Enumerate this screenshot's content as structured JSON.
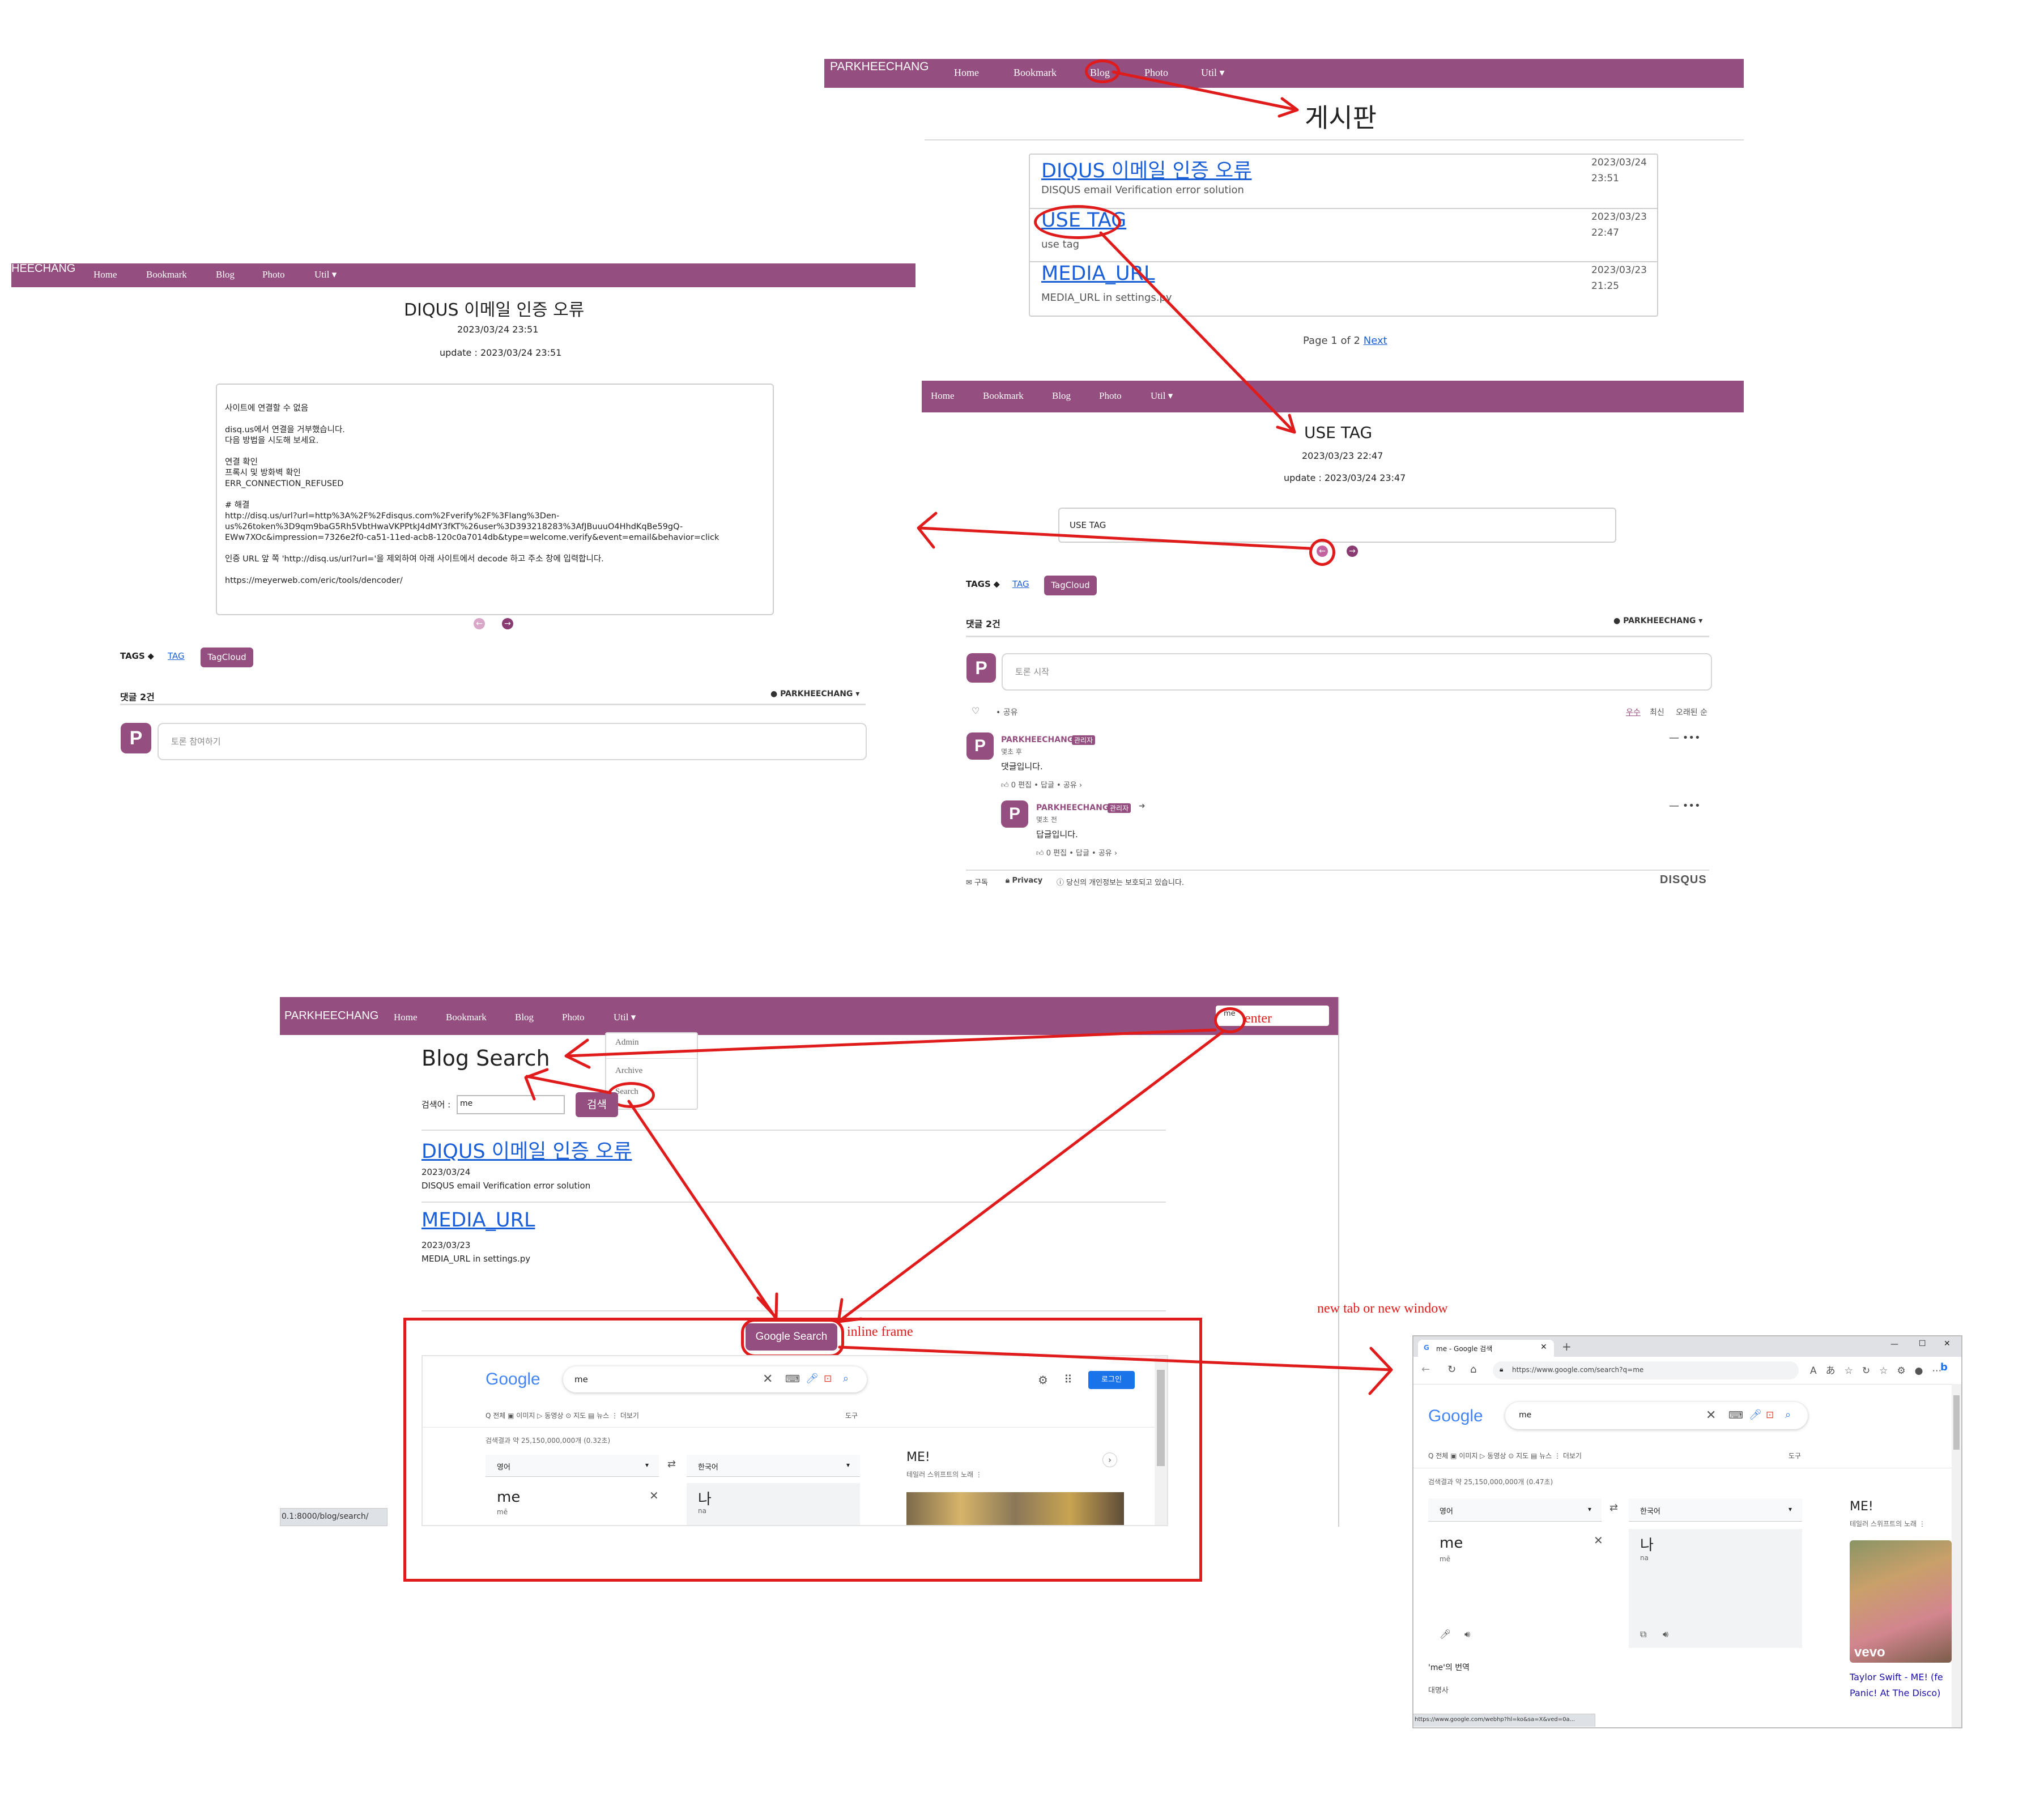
{
  "nav": {
    "brand": "PARKHEECHANG",
    "brand_cut": "HEECHANG",
    "home": "Home",
    "bookmark": "Bookmark",
    "blog": "Blog",
    "photo": "Photo",
    "util": "Util ▾"
  },
  "board": {
    "heading": "게시판",
    "posts": [
      {
        "title": "DIQUS 이메일 인증 오류",
        "summary": "DISQUS email Verification error solution",
        "date": "2023/03/24",
        "time": "23:51"
      },
      {
        "title": "USE TAG",
        "summary": "use tag",
        "date": "2023/03/23",
        "time": "22:47"
      },
      {
        "title": "MEDIA_URL",
        "summary": "MEDIA_URL in settings.py",
        "date": "2023/03/23",
        "time": "21:25"
      }
    ],
    "pagination_prefix": "Page 1 of 2",
    "pagination_next": "Next"
  },
  "post_detail": {
    "title": "DIQUS 이메일 인증 오류",
    "date": "2023/03/24 23:51",
    "update": "update : 2023/03/24 23:51",
    "content": {
      "l1": "사이트에 연결할 수 없음",
      "l2": "disq.us에서 연결을 거부했습니다.",
      "l3": "다음 방법을 시도해 보세요.",
      "l4": "연결 확인",
      "l5": "프록시 및 방화벽 확인",
      "l6": "ERR_CONNECTION_REFUSED",
      "l7": "# 해결",
      "l8": "http://disq.us/url?url=http%3A%2F%2Fdisqus.com%2Fverify%2F%3Flang%3Den-",
      "l9": "us%26token%3D9qm9baG5Rh5VbtHwaVKPPtkJ4dMY3fKT%26user%3D393218283%3AfJBuuuO4HhdKqBe59gQ-",
      "l10": "EWw7XOc&impression=7326e2f0-ca51-11ed-acb8-120c0a7014db&type=welcome.verify&event=email&behavior=click",
      "l11": "인증 URL 앞 쪽 'http://disq.us/url?url='을 제외하여 아래 사이트에서 decode 하고 주소 창에 입력합니다.",
      "l12": "https://meyerweb.com/eric/tools/dencoder/"
    },
    "tags_label": "TAGS",
    "tag": "TAG",
    "tagcloud": "TagCloud",
    "comments_count": "댓글 2건",
    "account": "PARKHEECHANG ▾",
    "avatar_letter": "P",
    "comment_placeholder": "토론 참여하기"
  },
  "tag_detail": {
    "title": "USE TAG",
    "date": "2023/03/23 22:47",
    "update": "update : 2023/03/24 23:47",
    "content": "USE TAG",
    "tags_label": "TAGS",
    "tag": "TAG",
    "tagcloud": "TagCloud",
    "comments_count": "댓글 2건",
    "account": "PARKHEECHANG ▾",
    "avatar_letter": "P",
    "comment_placeholder": "토론 시작",
    "share": "• 공유",
    "sort": {
      "best": "우수",
      "newest": "최신",
      "oldest": "오래된 순"
    },
    "comments": [
      {
        "author": "PARKHEECHANG",
        "badge": "관리자",
        "time": "몇초 후",
        "text": "댓글입니다.",
        "actions": "0   편집 • 답글 • 공유 ›"
      },
      {
        "author": "PARKHEECHANG",
        "badge": "관리자",
        "time": "몇초 전",
        "text": "답글입니다.",
        "actions": "0   편집 • 답글 • 공유 ›"
      }
    ],
    "footer": {
      "subscribe": "구독",
      "privacy": "Privacy",
      "notice": "당신의 개인정보는 보호되고 있습니다.",
      "brand": "DISQUS"
    }
  },
  "search_page": {
    "search_box_value": "me",
    "enter_label": "enter",
    "dropdown": [
      "Admin",
      "Archive",
      "Search"
    ],
    "title": "Blog Search",
    "query_label": "검색어 :",
    "query_value": "me",
    "search_button": "검색",
    "results": [
      {
        "title": "DIQUS 이메일 인증 오류",
        "date": "2023/03/24",
        "summary": "DISQUS email Verification error solution"
      },
      {
        "title": "MEDIA_URL",
        "date": "2023/03/23",
        "summary": "MEDIA_URL in settings.py"
      }
    ],
    "google_button": "Google Search",
    "inline_label": "inline frame",
    "status_url": "0.1:8000/blog/search/"
  },
  "google_inline": {
    "logo": "Google",
    "query": "me",
    "login": "로그인",
    "tabs": "Q 전체   ▣ 이미지   ▷ 동영상   ⊙ 지도   ▤ 뉴스   ⋮ 더보기",
    "tools": "도구",
    "stats": "검색결과 약 25,150,000,000개 (0.32초)",
    "src_lang": "영어",
    "dst_lang": "한국어",
    "word": "me",
    "pron": "mē",
    "translation": "나",
    "trans_pron": "na",
    "kp_title": "ME!",
    "kp_sub": "테일러 스위프트의 노래"
  },
  "new_window": {
    "label": "new tab or new window",
    "tab_title": "me - Google 검색",
    "url": "https://www.google.com/search?q=me",
    "logo": "Google",
    "query": "me",
    "tabs": "Q 전체   ▣ 이미지   ▷ 동영상   ⊙ 지도   ▤ 뉴스   ⋮ 더보기",
    "tools": "도구",
    "stats": "검색결과 약 25,150,000,000개 (0.47초)",
    "src_lang": "영어",
    "dst_lang": "한국어",
    "word": "me",
    "pron": "mē",
    "translation": "나",
    "trans_pron": "na",
    "translate_of": "'me'의 번역",
    "pos": "대명사",
    "kp_title": "ME!",
    "kp_sub": "테일러 스위프트의 노래",
    "video_caption1": "Taylor Swift - ME! (fe",
    "video_caption2": "Panic! At The Disco)",
    "vevo": "vevo",
    "status_url": "https://www.google.com/webhp?hl=ko&sa=X&ved=0a..."
  },
  "colors": {
    "brand": "#944e7f",
    "annotation": "#e01b1b",
    "link": "#1a5fd6",
    "google_blue": "#1a73e8"
  }
}
